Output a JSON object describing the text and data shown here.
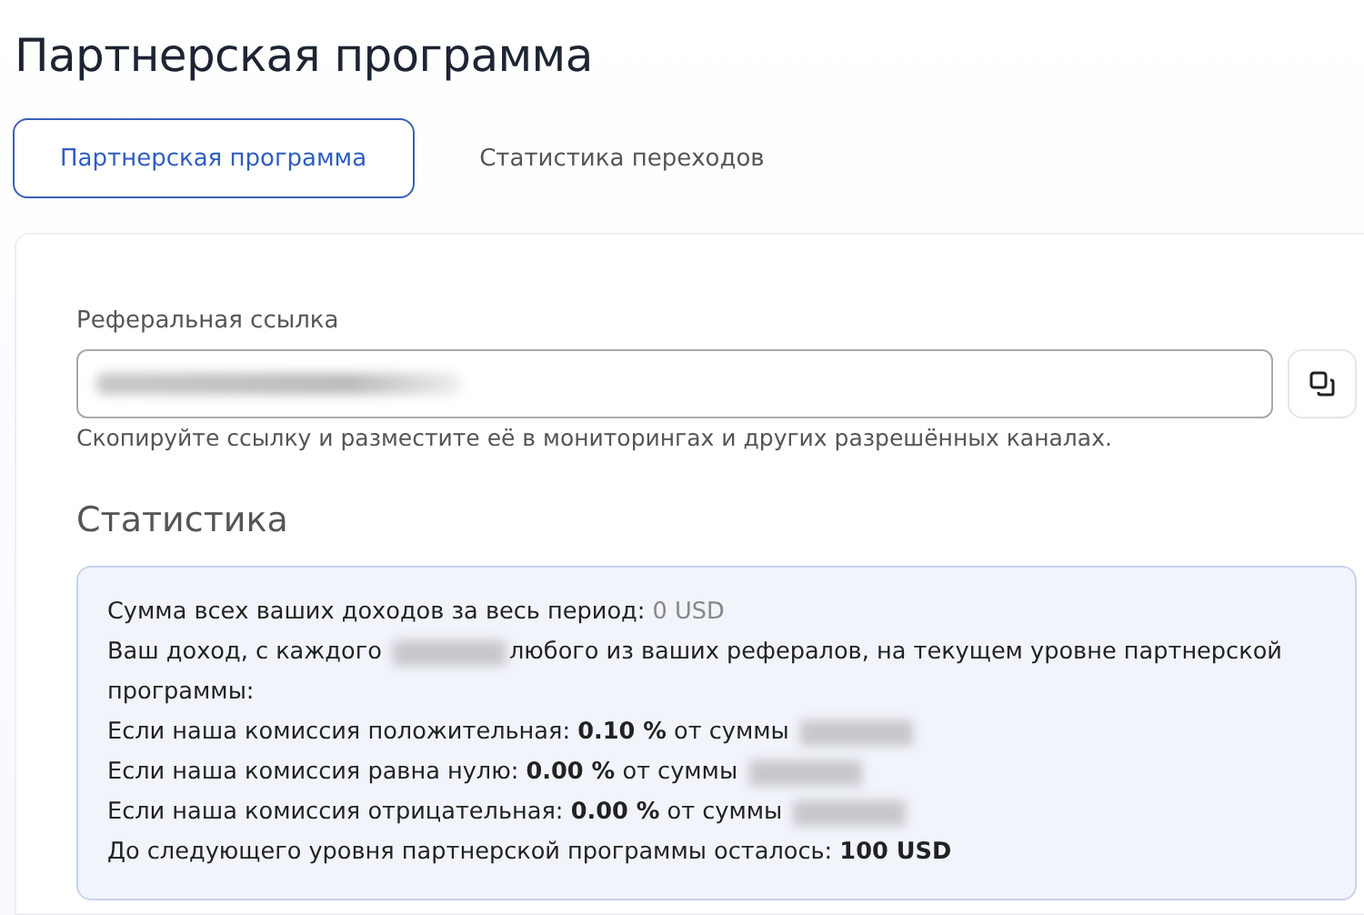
{
  "page_title": "Партнерская программа",
  "tabs": [
    {
      "label": "Партнерская программа",
      "selected": true
    },
    {
      "label": "Статистика переходов",
      "selected": false
    }
  ],
  "referral": {
    "label": "Реферальная ссылка",
    "value_redacted": true,
    "hint": "Скопируйте ссылку и разместите её в мониторингах и других разрешённых каналах."
  },
  "statistics": {
    "title": "Статистика",
    "lines": [
      {
        "text": "Сумма всех ваших доходов за весь период:",
        "amount": "0 USD"
      },
      {
        "text": "Ваш доход, с каждого",
        "redacted": true,
        "text_after": "любого из ваших рефералов, на текущем уровне партнерской"
      },
      {
        "text": "программы:"
      },
      {
        "text": "Если наша комиссия положительная: **0.10 %** от суммы",
        "redacted": true
      },
      {
        "text": "Если наша комиссия равна нулю: **0.00 %** от суммы",
        "redacted": true
      },
      {
        "text": "Если наша комиссия отрицательная: **0.00 %** от суммы",
        "redacted": true
      },
      {
        "text": "До следующего уровня партнерской программы осталось: **100 USD**"
      }
    ]
  }
}
